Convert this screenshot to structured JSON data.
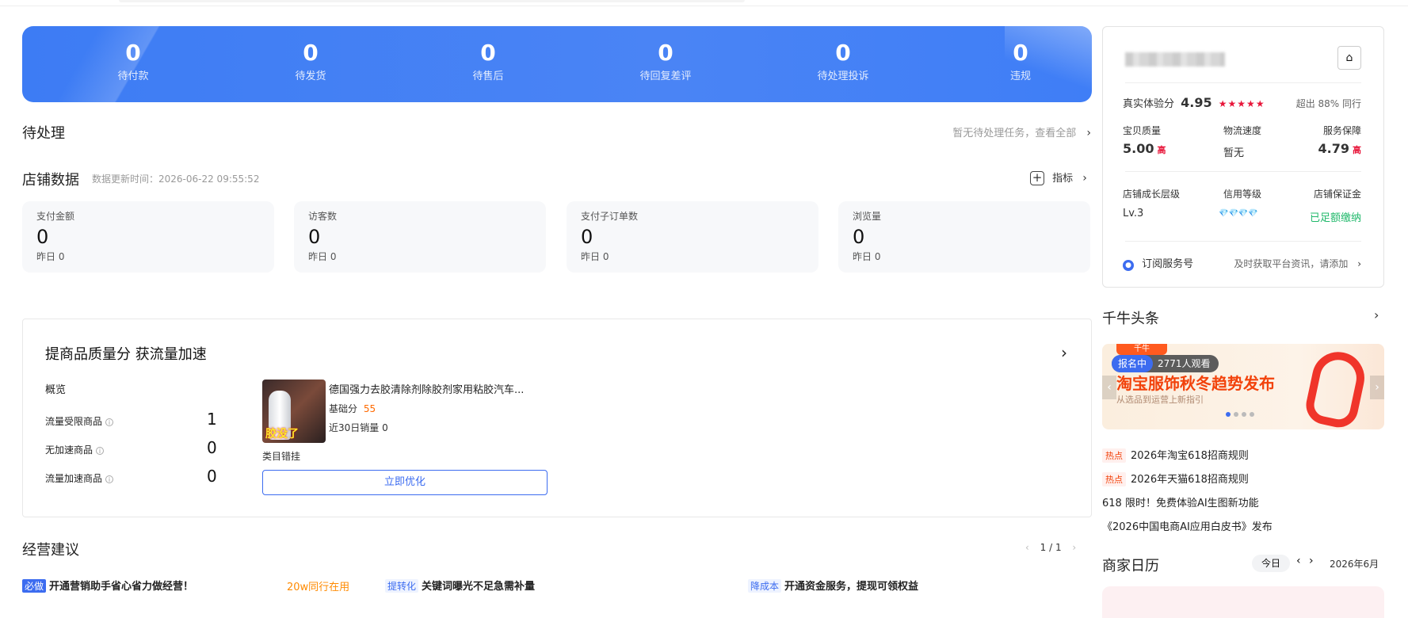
{
  "banner": {
    "stats": [
      {
        "value": "0",
        "label": "待付款"
      },
      {
        "value": "0",
        "label": "待发货"
      },
      {
        "value": "0",
        "label": "待售后"
      },
      {
        "value": "0",
        "label": "待回复差评"
      },
      {
        "value": "0",
        "label": "待处理投诉"
      },
      {
        "value": "0",
        "label": "违规"
      }
    ]
  },
  "pending": {
    "title": "待处理",
    "link": "暂无待处理任务，查看全部"
  },
  "store_data": {
    "title": "店铺数据",
    "update_time": "数据更新时间：2026-06-22 09:55:52",
    "indicator_label": "指标",
    "cards": [
      {
        "title": "支付金额",
        "value": "0",
        "yesterday": "昨日 0"
      },
      {
        "title": "访客数",
        "value": "0",
        "yesterday": "昨日 0"
      },
      {
        "title": "支付子订单数",
        "value": "0",
        "yesterday": "昨日 0"
      },
      {
        "title": "浏览量",
        "value": "0",
        "yesterday": "昨日 0"
      }
    ]
  },
  "quality": {
    "title": "提商品质量分 获流量加速",
    "overview": "概览",
    "rows": [
      {
        "label": "流量受限商品",
        "value": "1"
      },
      {
        "label": "无加速商品",
        "value": "0"
      },
      {
        "label": "流量加速商品",
        "value": "0"
      }
    ],
    "product": {
      "name": "德国强力去胶清除剂除胶剂家用粘胶汽车...",
      "base_score_label": "基础分",
      "base_score": "55",
      "sales": "近30日销量 0",
      "image_text": "胶没了",
      "issue": "类目错挂",
      "button": "立即优化"
    }
  },
  "business": {
    "title": "经营建议",
    "pager": "1 / 1",
    "items": [
      {
        "tag": "必做",
        "text": "开通营销助手省心省力做经营！",
        "note": "20w同行在用"
      },
      {
        "tag": "提转化",
        "text": "关键词曝光不足急需补量"
      },
      {
        "tag": "降成本",
        "text": "开通资金服务，提现可领权益"
      }
    ]
  },
  "shop_panel": {
    "experience_label": "真实体验分",
    "experience_score": "4.95",
    "stars": "★★★★★",
    "beat": "超出 88% 同行",
    "metrics": [
      {
        "label": "宝贝质量",
        "value": "5.00",
        "flag": "高"
      },
      {
        "label": "物流速度",
        "value": "暂无"
      },
      {
        "label": "服务保障",
        "value": "4.79",
        "flag": "高"
      }
    ],
    "levels": [
      {
        "label": "店铺成长层级",
        "value": "Lv.3"
      },
      {
        "label": "信用等级",
        "value": "💎💎💎💎"
      },
      {
        "label": "店铺保证金",
        "value": "已足额缴纳"
      }
    ],
    "subscribe_label": "订阅服务号",
    "subscribe_hint": "及时获取平台资讯，请添加"
  },
  "qianniu": {
    "title": "千牛头条",
    "banner": {
      "brand": "千牛",
      "status": "报名中",
      "viewers": "2771人观看",
      "headline": "淘宝服饰秋冬趋势发布",
      "sub": "从选品到运营上新指引"
    },
    "news": [
      {
        "tag": "热点",
        "text": "2026年淘宝618招商规则"
      },
      {
        "tag": "热点",
        "text": "2026年天猫618招商规则"
      },
      {
        "text": "618 限时！免费体验AI生图新功能"
      },
      {
        "text": "《2026中国电商AI应用白皮书》发布"
      }
    ]
  },
  "calendar": {
    "title": "商家日历",
    "today": "今日",
    "month": "2026年6月"
  }
}
